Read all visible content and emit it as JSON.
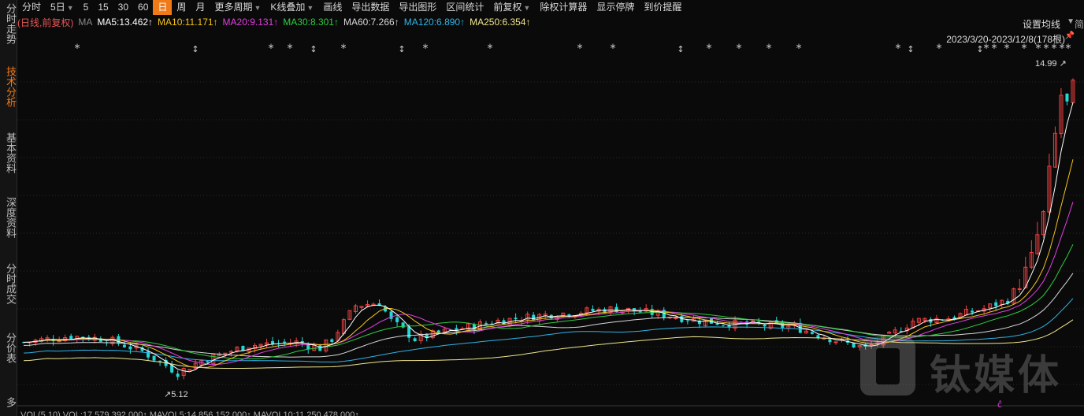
{
  "sidebar": {
    "items": [
      {
        "label": "分时走势",
        "active": false
      },
      {
        "label": "技术分析",
        "active": true
      },
      {
        "label": "基本资料",
        "active": false
      },
      {
        "label": "深度资料",
        "active": false
      },
      {
        "label": "分时成交",
        "active": false
      },
      {
        "label": "分价表",
        "active": false
      },
      {
        "label": "多",
        "active": false
      }
    ]
  },
  "toolbar": {
    "items": [
      {
        "label": "分时",
        "caret": false,
        "active": false
      },
      {
        "label": "5日",
        "caret": true,
        "active": false
      },
      {
        "label": "5",
        "caret": false,
        "active": false
      },
      {
        "label": "15",
        "caret": false,
        "active": false
      },
      {
        "label": "30",
        "caret": false,
        "active": false
      },
      {
        "label": "60",
        "caret": false,
        "active": false
      },
      {
        "label": "日",
        "caret": false,
        "active": true
      },
      {
        "label": "周",
        "caret": false,
        "active": false
      },
      {
        "label": "月",
        "caret": false,
        "active": false
      },
      {
        "label": "更多周期",
        "caret": true,
        "active": false
      },
      {
        "label": "K线叠加",
        "caret": true,
        "active": false
      },
      {
        "label": "画线",
        "caret": false,
        "active": false
      },
      {
        "label": "导出数据",
        "caret": false,
        "active": false
      },
      {
        "label": "导出图形",
        "caret": false,
        "active": false
      },
      {
        "label": "区间统计",
        "caret": false,
        "active": false
      },
      {
        "label": "前复权",
        "caret": true,
        "active": false
      },
      {
        "label": "除权计算器",
        "caret": false,
        "active": false
      },
      {
        "label": "显示停牌",
        "caret": false,
        "active": false
      },
      {
        "label": "到价提醒",
        "caret": false,
        "active": false
      }
    ]
  },
  "ma_bar": {
    "mode": "(日线,前复权)",
    "ma_label": "MA",
    "items": [
      {
        "label": "MA5:13.462↑",
        "color": "#ffffff"
      },
      {
        "label": "MA10:11.171↑",
        "color": "#f5c518"
      },
      {
        "label": "MA20:9.131↑",
        "color": "#e040e0"
      },
      {
        "label": "MA30:8.301↑",
        "color": "#2ecc40"
      },
      {
        "label": "MA60:7.266↑",
        "color": "#d8d8d8"
      },
      {
        "label": "MA120:6.890↑",
        "color": "#2fb4e6"
      },
      {
        "label": "MA250:6.354↑",
        "color": "#f0e68c"
      }
    ]
  },
  "header_right": {
    "settings_label": "设置均线",
    "date_range": "2023/3/20-2023/12/8(178根)",
    "edge_char": "简"
  },
  "chart_data": {
    "type": "candlestick",
    "high_label": "14.99",
    "low_label": "5.12",
    "overlays": [
      "MA5",
      "MA10",
      "MA20",
      "MA30",
      "MA60",
      "MA120",
      "MA250"
    ],
    "colors": {
      "up": "#f04040",
      "down": "#24d7d7",
      "ma5": "#ffffff",
      "ma10": "#f5c518",
      "ma20": "#e040e0",
      "ma30": "#2ecc40",
      "ma60": "#d8d8d8",
      "ma120": "#2fb4e6",
      "ma250": "#f0e68c"
    },
    "event_markers": [
      "*",
      "↕"
    ]
  },
  "watermark": {
    "text": "钛媒体"
  },
  "bottom_bar": {
    "text": "VOL(5,10)  VOL:17,579,392.000↑  MAVOL5:14,856,152.000↑  MAVOL10:11,250,478.000↑"
  }
}
